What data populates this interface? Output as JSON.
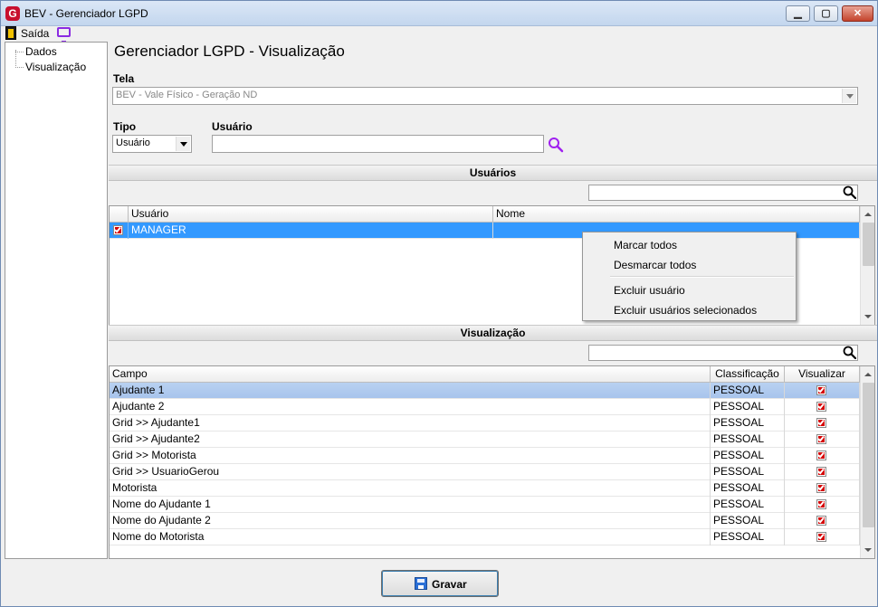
{
  "window": {
    "title": "BEV - Gerenciador LGPD",
    "minimize_glyph": "▁",
    "maximize_glyph": "▢",
    "close_glyph": "✕"
  },
  "menubar": {
    "exit_label": "Saída"
  },
  "tree": {
    "items": [
      "Dados",
      "Visualização"
    ]
  },
  "page_title": "Gerenciador LGPD - Visualização",
  "tela": {
    "label": "Tela",
    "value": "BEV - Vale Físico - Geração ND"
  },
  "tipo": {
    "label": "Tipo",
    "value": "Usuário"
  },
  "usuario": {
    "label": "Usuário",
    "value": ""
  },
  "usuarios_section": {
    "title": "Usuários",
    "search_value": "",
    "columns": [
      "Usuário",
      "Nome"
    ],
    "rows": [
      {
        "checked": true,
        "usuario": "MANAGER",
        "nome": ""
      }
    ]
  },
  "context_menu": {
    "items": [
      "Marcar todos",
      "Desmarcar todos",
      "Excluir usuário",
      "Excluir usuários selecionados"
    ]
  },
  "visualizacao_section": {
    "title": "Visualização",
    "search_value": "",
    "columns": [
      "Campo",
      "Classificação",
      "Visualizar"
    ],
    "rows": [
      {
        "campo": "Ajudante 1",
        "classificacao": "PESSOAL",
        "visualizar": true
      },
      {
        "campo": "Ajudante 2",
        "classificacao": "PESSOAL",
        "visualizar": true
      },
      {
        "campo": "Grid >> Ajudante1",
        "classificacao": "PESSOAL",
        "visualizar": true
      },
      {
        "campo": "Grid >> Ajudante2",
        "classificacao": "PESSOAL",
        "visualizar": true
      },
      {
        "campo": "Grid >> Motorista",
        "classificacao": "PESSOAL",
        "visualizar": true
      },
      {
        "campo": "Grid >> UsuarioGerou",
        "classificacao": "PESSOAL",
        "visualizar": true
      },
      {
        "campo": "Motorista",
        "classificacao": "PESSOAL",
        "visualizar": true
      },
      {
        "campo": "Nome do Ajudante 1",
        "classificacao": "PESSOAL",
        "visualizar": true
      },
      {
        "campo": "Nome do Ajudante 2",
        "classificacao": "PESSOAL",
        "visualizar": true
      },
      {
        "campo": "Nome do Motorista",
        "classificacao": "PESSOAL",
        "visualizar": true
      }
    ]
  },
  "save_button": {
    "label": "Gravar"
  },
  "colors": {
    "selection": "#3399ff",
    "checkbox_red": "#d40000",
    "search_purple": "#a020f0"
  }
}
